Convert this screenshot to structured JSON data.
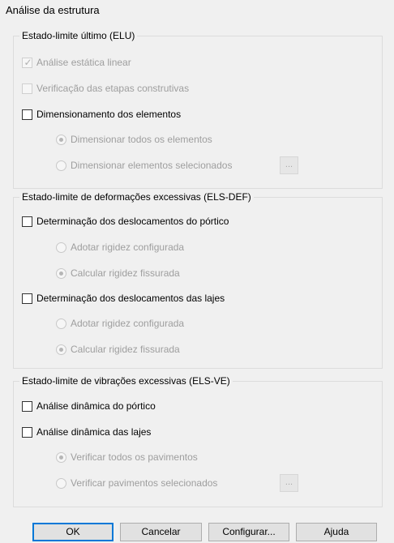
{
  "title": "Análise da estrutura",
  "elu": {
    "legend": "Estado-limite último (ELU)",
    "analise_estatica": "Análise estática linear",
    "verificacao_etapas": "Verificação das etapas construtivas",
    "dimensionamento": "Dimensionamento dos elementos",
    "dimensionar_todos": "Dimensionar todos os elementos",
    "dimensionar_selecionados": "Dimensionar elementos selecionados",
    "ellipsis": "..."
  },
  "els_def": {
    "legend": "Estado-limite de deformações excessivas (ELS-DEF)",
    "desl_portico": "Determinação dos deslocamentos do pórtico",
    "portico_adotar": "Adotar rigidez configurada",
    "portico_calcular": "Calcular rigidez fissurada",
    "desl_lajes": "Determinação dos deslocamentos das lajes",
    "lajes_adotar": "Adotar rigidez configurada",
    "lajes_calcular": "Calcular rigidez fissurada"
  },
  "els_ve": {
    "legend": "Estado-limite de vibrações excessivas (ELS-VE)",
    "dinamica_portico": "Análise dinâmica do pórtico",
    "dinamica_lajes": "Análise dinâmica das lajes",
    "verificar_todos": "Verificar todos os pavimentos",
    "verificar_selecionados": "Verificar pavimentos selecionados",
    "ellipsis": "..."
  },
  "buttons": {
    "ok": "OK",
    "cancelar": "Cancelar",
    "configurar": "Configurar...",
    "ajuda": "Ajuda"
  },
  "colors": {
    "background": "#f0f0f0",
    "default_button_border": "#0078d7",
    "disabled_text": "#9e9e9e"
  }
}
